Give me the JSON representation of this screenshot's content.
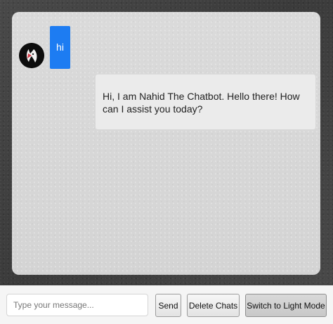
{
  "chat": {
    "user_message": "hi",
    "bot_message": "Hi, I am Nahid The Chatbot. Hello there! How can I assist you today?",
    "avatar_icon": "chatbot-avatar-icon"
  },
  "composer": {
    "placeholder": "Type your message...",
    "send_label": "Send",
    "delete_label": "Delete Chats",
    "mode_label": "Switch to Light Mode"
  },
  "colors": {
    "user_bubble": "#1d7cf2",
    "bot_bubble": "#ebebeb",
    "chat_background": "#d6d6d6"
  }
}
